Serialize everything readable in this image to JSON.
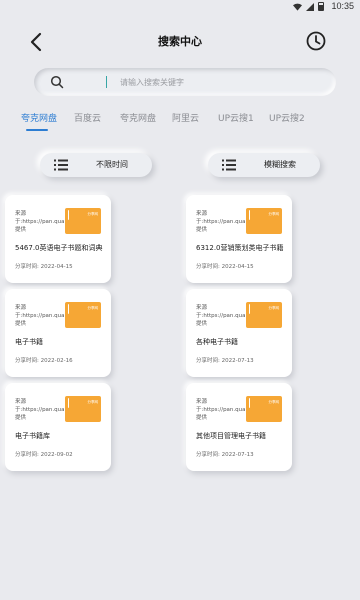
{
  "status_bar": {
    "time": "10:35"
  },
  "header": {
    "title": "搜索中心"
  },
  "search": {
    "placeholder": "请输入搜索关键字"
  },
  "tabs": [
    {
      "label": "夸克网盘",
      "active": true
    },
    {
      "label": "百度云",
      "active": false
    },
    {
      "label": "夸克网盘",
      "active": false
    },
    {
      "label": "阿里云",
      "active": false
    },
    {
      "label": "UP云搜1",
      "active": false
    },
    {
      "label": "UP云搜2",
      "active": false
    }
  ],
  "filters": {
    "time_label": "不限时间",
    "fuzzy_label": "模糊搜索"
  },
  "card_common": {
    "source_text": "来源于:https://pan.quark.com/提供",
    "thumb_label": "分享网",
    "date_prefix": "分享时间: "
  },
  "cards": [
    {
      "title": "5467.0英语电子书题和词典",
      "date": "分享时间: 2022-04-15"
    },
    {
      "title": "6312.0营销策划类电子书籍",
      "date": "分享时间: 2022-04-15"
    },
    {
      "title": "电子书籍",
      "date": "分享时间: 2022-02-16"
    },
    {
      "title": "各种电子书籍",
      "date": "分享时间: 2022-07-13"
    },
    {
      "title": "电子书籍库",
      "date": "分享时间: 2022-09-02"
    },
    {
      "title": "其他项目管理电子书籍",
      "date": "分享时间: 2022-07-13"
    }
  ],
  "colors": {
    "accent": "#2d7dd2",
    "thumb": "#f6a735",
    "background": "#e9eaee"
  },
  "icons": {
    "back": "chevron-left-icon",
    "history": "clock-icon",
    "search": "search-icon",
    "list": "list-icon"
  }
}
